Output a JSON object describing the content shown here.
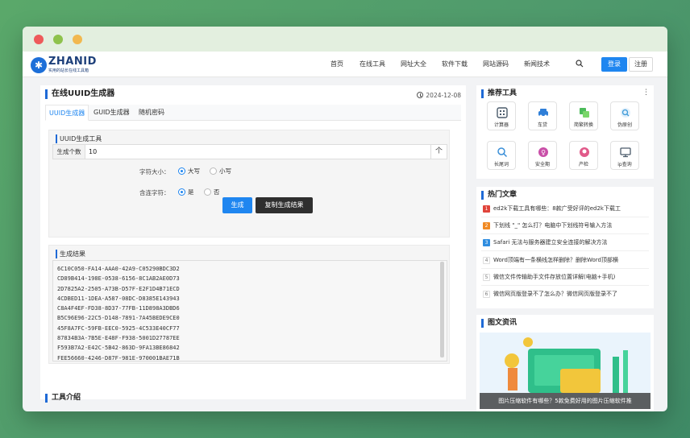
{
  "nav": {
    "logo_text": "ZHANID",
    "logo_sub": "实用的站长在线工具箱",
    "items": [
      "首页",
      "在线工具",
      "网址大全",
      "软件下载",
      "网站源码",
      "新闻技术"
    ],
    "login": "登录",
    "register": "注册"
  },
  "main": {
    "title": "在线UUID生成器",
    "date": "2024-12-08",
    "tabs": [
      "UUID生成器",
      "GUID生成器",
      "随机密码"
    ],
    "panel_title": "UUID生成工具",
    "count_label": "生成个数",
    "count_value": "10",
    "count_arrow": "个",
    "case_label": "字符大小：",
    "case_upper": "大写",
    "case_lower": "小写",
    "hyphen_label": "含连字符：",
    "hyphen_yes": "是",
    "hyphen_no": "否",
    "generate": "生成",
    "copy": "复制生成结果",
    "result_title": "生成结果",
    "results": [
      "6C10C050-FA14-AAA0-42A9-C05290BDC3D2",
      "CD89B414-198E-0538-6156-8C1AB2AE0D73",
      "2D7825A2-2505-A73B-D57F-E2F1D4B71ECD",
      "4CDBED11-1DEA-A587-08DC-D8385E143943",
      "C8A4F4EF-FD38-8D37-77FB-11D898A3DBD6",
      "B5C96E96-22C5-D148-7891-7A45BEDE9CE0",
      "45F8A7FC-59FB-EEC0-5925-4C533E40CF77",
      "87834B3A-7B5E-E48F-F938-5001D27787EE",
      "F593B7A2-E42C-5B42-863D-9FA13BE86842",
      "FEE56660-4246-D87F-981E-970001BAE71B"
    ],
    "intro_title": "工具介绍"
  },
  "sidebar": {
    "recommend_title": "推荐工具",
    "tools": [
      {
        "label": "计算器",
        "icon": "calculator-icon",
        "color": "#4a5a6a"
      },
      {
        "label": "车贷",
        "icon": "car-icon",
        "color": "#2f7fd8"
      },
      {
        "label": "简繁转换",
        "icon": "convert-icon",
        "color": "#4cbb5a"
      },
      {
        "label": "伪原创",
        "icon": "search-doc-icon",
        "color": "#3d9ad8"
      },
      {
        "label": "长尾词",
        "icon": "magnifier-icon",
        "color": "#3a8fd8"
      },
      {
        "label": "安全期",
        "icon": "safety-icon",
        "color": "#c94fa8"
      },
      {
        "label": "产检",
        "icon": "checkup-icon",
        "color": "#e15a8a"
      },
      {
        "label": "ip查询",
        "icon": "monitor-icon",
        "color": "#4a5a6a"
      }
    ],
    "hot_title": "热门文章",
    "articles": [
      {
        "num": "1",
        "text": "ed2k下载工具有哪些：8款广受好评的ed2k下载工",
        "color": "#e0443b"
      },
      {
        "num": "2",
        "text": "下划线 \"_\" 怎么打？电脑中下划线符号输入方法",
        "color": "#f08a24"
      },
      {
        "num": "3",
        "text": "Safari 无法与服务器建立安全连接的解决方法",
        "color": "#2f8de0"
      },
      {
        "num": "4",
        "text": "Word顶端有一条横线怎样删除？删除Word顶部横",
        "color": ""
      },
      {
        "num": "5",
        "text": "微信文件传输助手文件存放位置详解(电脑+手机)",
        "color": ""
      },
      {
        "num": "6",
        "text": "微信网页版登录不了怎么办？微信网页版登录不了",
        "color": ""
      }
    ],
    "news_title": "图文资讯",
    "news_caption": "图片压缩软件有哪些？5款免费好用的图片压缩软件推"
  }
}
